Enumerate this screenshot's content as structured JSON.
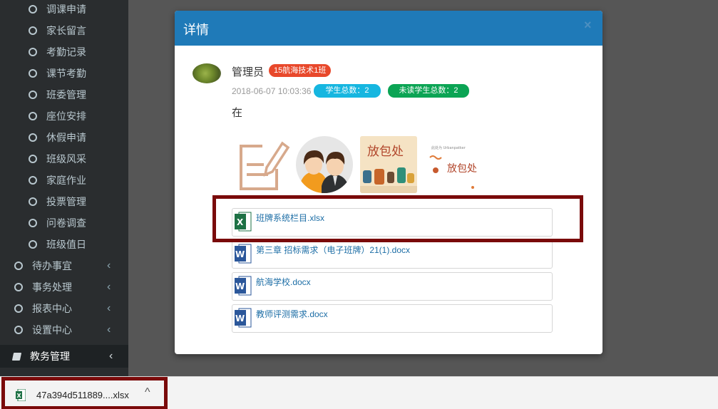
{
  "sidebar": {
    "sub_items": [
      {
        "label": "调课申请"
      },
      {
        "label": "家长留言"
      },
      {
        "label": "考勤记录"
      },
      {
        "label": "课节考勤"
      },
      {
        "label": "班委管理"
      },
      {
        "label": "座位安排"
      },
      {
        "label": "休假申请"
      },
      {
        "label": "班级风采"
      },
      {
        "label": "家庭作业"
      },
      {
        "label": "投票管理"
      },
      {
        "label": "问卷调查"
      },
      {
        "label": "班级值日"
      }
    ],
    "top_items": [
      {
        "label": "待办事宜",
        "chevron": "‹"
      },
      {
        "label": "事务处理",
        "chevron": "‹"
      },
      {
        "label": "报表中心",
        "chevron": "‹"
      },
      {
        "label": "设置中心",
        "chevron": "‹"
      }
    ],
    "main_item": {
      "label": "教务管理",
      "chevron": "‹",
      "icon": "book-icon"
    }
  },
  "modal": {
    "title": "详情",
    "close": "×",
    "post": {
      "poster": "管理员",
      "class_badge": "15航海技术1班",
      "time": "2018-06-07 10:03:36",
      "total_badge": "学生总数：2",
      "unread_badge": "未读学生总数：2",
      "content": "在",
      "thumb3_text": "放包处",
      "thumb4_text": "放包处",
      "thumb4_small": "此处为 Urbanpatker"
    },
    "files": [
      {
        "name": "班牌系统栏目.xlsx",
        "type": "excel"
      },
      {
        "name": "第三章 招标需求（电子班牌）21(1).docx",
        "type": "word"
      },
      {
        "name": "航海学校.docx",
        "type": "word"
      },
      {
        "name": "教师评测需求.docx",
        "type": "word"
      }
    ]
  },
  "download_bar": {
    "filename": "47a394d511889....xlsx",
    "chevron": "^"
  },
  "colors": {
    "header_blue": "#1f7ab8",
    "class_badge_red": "#e8482b",
    "total_badge_cyan": "#16b6e0",
    "unread_badge_green": "#0ba454",
    "highlight_red": "#7a0a0a",
    "link_blue": "#1d6ea6"
  }
}
